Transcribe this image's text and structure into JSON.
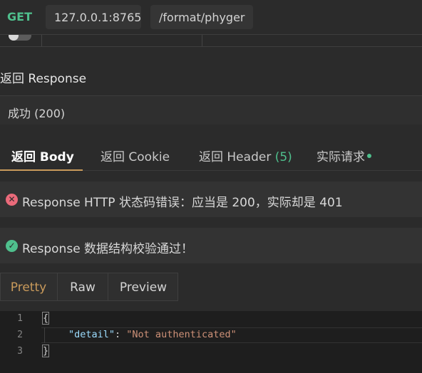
{
  "request": {
    "method": "GET",
    "host": "127.0.0.1:8765",
    "path": "/format/phyger"
  },
  "response": {
    "section_title": "返回 Response",
    "status": "成功 (200)",
    "tabs": [
      {
        "label": "返回 Body"
      },
      {
        "label": "返回 Cookie"
      },
      {
        "label": "返回 Header ",
        "count": "(5)"
      },
      {
        "label": "实际请求"
      }
    ],
    "assertions": [
      {
        "status": "error",
        "text": "Response HTTP 状态码错误：应当是 200，实际却是 401"
      },
      {
        "status": "success",
        "text": "Response 数据结构校验通过！"
      }
    ],
    "view_modes": [
      "Pretty",
      "Raw",
      "Preview"
    ],
    "code": {
      "line_numbers": [
        "1",
        "2",
        "3"
      ],
      "open_brace": "{",
      "key": "\"detail\"",
      "colon": ": ",
      "value": "\"Not authenticated\"",
      "close_brace": "}"
    }
  }
}
